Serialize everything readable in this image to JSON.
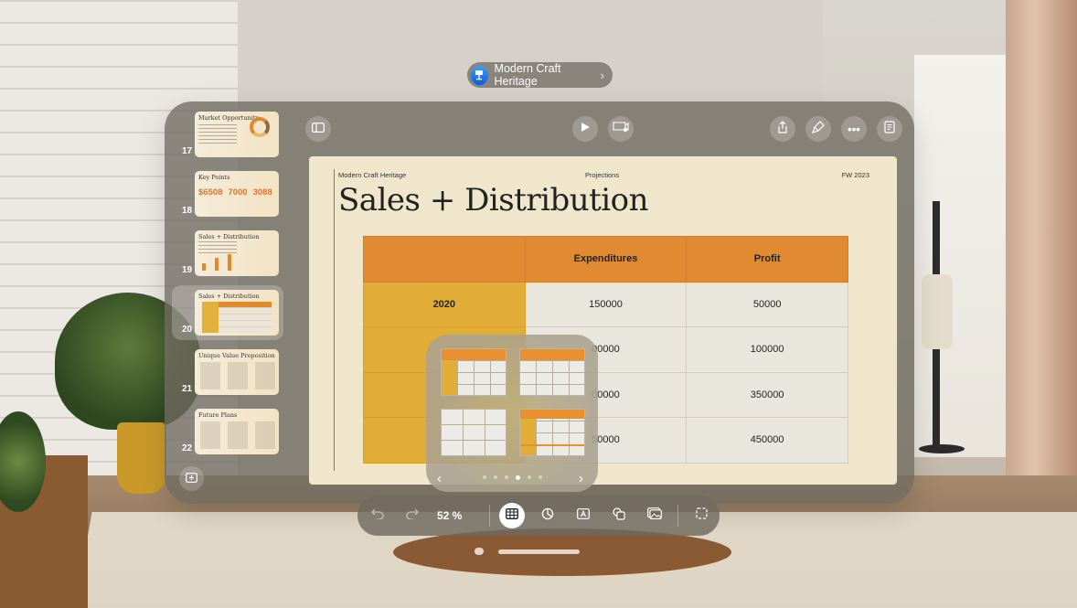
{
  "window": {
    "title": "Modern Craft Heritage"
  },
  "sidebar": {
    "slides": [
      {
        "number": "17",
        "title": "Market Opportunity"
      },
      {
        "number": "18",
        "title": "Key Points",
        "figures": [
          "$6508",
          "7000",
          "3088"
        ]
      },
      {
        "number": "19",
        "title": "Sales + Distribution"
      },
      {
        "number": "20",
        "title": "Sales + Distribution",
        "selected": true
      },
      {
        "number": "21",
        "title": "Unique Value Proposition"
      },
      {
        "number": "22",
        "title": "Future Plans"
      }
    ]
  },
  "icons": {
    "sidebar_toggle": "sidebar-icon",
    "play": "play-icon",
    "animate": "slide-animation-icon",
    "share": "share-icon",
    "format": "paintbrush-icon",
    "more": "ellipsis-icon",
    "notes": "presenter-notes-icon",
    "add_slide": "add-slide-icon"
  },
  "slide": {
    "header_left": "Modern Craft Heritage",
    "header_center": "Projections",
    "header_right": "FW 2023",
    "heading": "Sales + Distribution",
    "table": {
      "columns": [
        "",
        "Expenditures",
        "Profit"
      ],
      "rows": [
        {
          "label": "2020",
          "expenditures": "150000",
          "profit": "50000"
        },
        {
          "label": "",
          "expenditures": "00000",
          "profit": "100000"
        },
        {
          "label": "",
          "expenditures": "00000",
          "profit": "350000"
        },
        {
          "label": "",
          "expenditures": "50000",
          "profit": "450000"
        }
      ]
    }
  },
  "popover": {
    "styles": [
      "table-style-header-row-column",
      "table-style-header-row",
      "table-style-plain",
      "table-style-header-footer"
    ],
    "page_count": 6,
    "current_page": 4,
    "prev_label": "‹",
    "next_label": "›"
  },
  "bottom_toolbar": {
    "zoom": "52 %",
    "colors": {
      "accent_orange": "#e08a32",
      "accent_gold": "#e2ad37"
    }
  }
}
